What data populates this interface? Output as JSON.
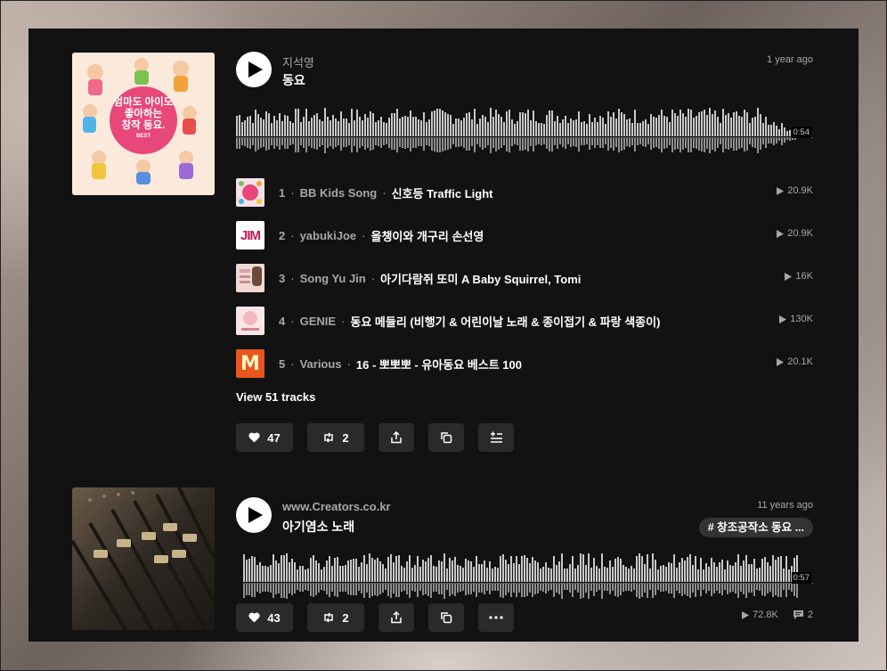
{
  "colors": {
    "background": "#121212",
    "button": "#2a2a2a",
    "muted": "#a7a7a7",
    "text": "#ffffff",
    "wave": "#c8c8c8"
  },
  "track1": {
    "artist": "지석영",
    "title": "동요",
    "age": "1 year ago",
    "duration": "0:54",
    "artwork": {
      "lines": [
        "엄마도 아이도",
        "좋아하는",
        "창작 동요."
      ],
      "sub": "BEST"
    },
    "list": [
      {
        "num": "1",
        "artist": "BB Kids Song",
        "title": "신호등 Traffic Light",
        "plays": "20.9K",
        "thumb_color": "#f6e1e8"
      },
      {
        "num": "2",
        "artist": "yabukiJoe",
        "title": "올챙이와 개구리 손선영",
        "plays": "20.9K",
        "thumb_color": "#ffffff",
        "thumb_text": "JIM"
      },
      {
        "num": "3",
        "artist": "Song Yu Jin",
        "title": "아기다람쥐 또미 A Baby Squirrel, Tomi",
        "plays": "16K",
        "thumb_color": "#f1d8d3"
      },
      {
        "num": "4",
        "artist": "GENIE",
        "title": "동요 메들리 (비행기 & 어린이날 노래 & 종이접기 & 파랑 색종이)",
        "plays": "130K",
        "thumb_color": "#f8e6e6"
      },
      {
        "num": "5",
        "artist": "Various",
        "title": "16 - 뽀뽀뽀 - 유아동요 베스트 100",
        "plays": "20.1K",
        "thumb_color": "#e8561e",
        "thumb_text": "M"
      }
    ],
    "view_all": "View 51 tracks",
    "likes": "47",
    "reposts": "2"
  },
  "track2": {
    "artist": "www.Creators.co.kr",
    "title": "아기염소 노래",
    "age": "11 years ago",
    "tag": "# 창조공작소 동요 ...",
    "duration": "0:57",
    "likes": "43",
    "reposts": "2",
    "plays": "72.8K",
    "comments": "2"
  },
  "separator": "·"
}
